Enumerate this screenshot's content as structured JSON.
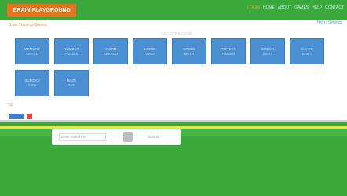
{
  "header": {
    "brand": "BRAIN PLAYGROUND",
    "links": [
      "LOGIN",
      "HOME",
      "ABOUT",
      "GAMES",
      "HELP",
      "CONTACT"
    ]
  },
  "page": {
    "subtitle": "Brain Training Games",
    "help_link": "Help | Settings",
    "grid_title": "SELECT A GAME"
  },
  "tiles": [
    {
      "line1": "MEMORY",
      "line2": "MATCH"
    },
    {
      "line1": "NUMBER",
      "line2": "PUZZLE"
    },
    {
      "line1": "WORD",
      "line2": "SEARCH"
    },
    {
      "line1": "LOGIC",
      "line2": "GRID"
    },
    {
      "line1": "SPEED",
      "line2": "MATH"
    },
    {
      "line1": "PATTERN",
      "line2": "FINDER"
    },
    {
      "line1": "COLOR",
      "line2": "SORT"
    },
    {
      "line1": "SHAPE",
      "line2": "SHIFT"
    },
    {
      "line1": "SUDOKU",
      "line2": "MINI"
    },
    {
      "line1": "MAZE",
      "line2": "RUN"
    }
  ],
  "footer": {
    "note": "Tip",
    "input_placeholder": "Enter code here",
    "trailing_text": "Submit"
  },
  "colors": {
    "green": "#3aa83a",
    "orange": "#e8731e",
    "tile_blue": "#4a90d2",
    "yellow": "#f2e23c"
  }
}
